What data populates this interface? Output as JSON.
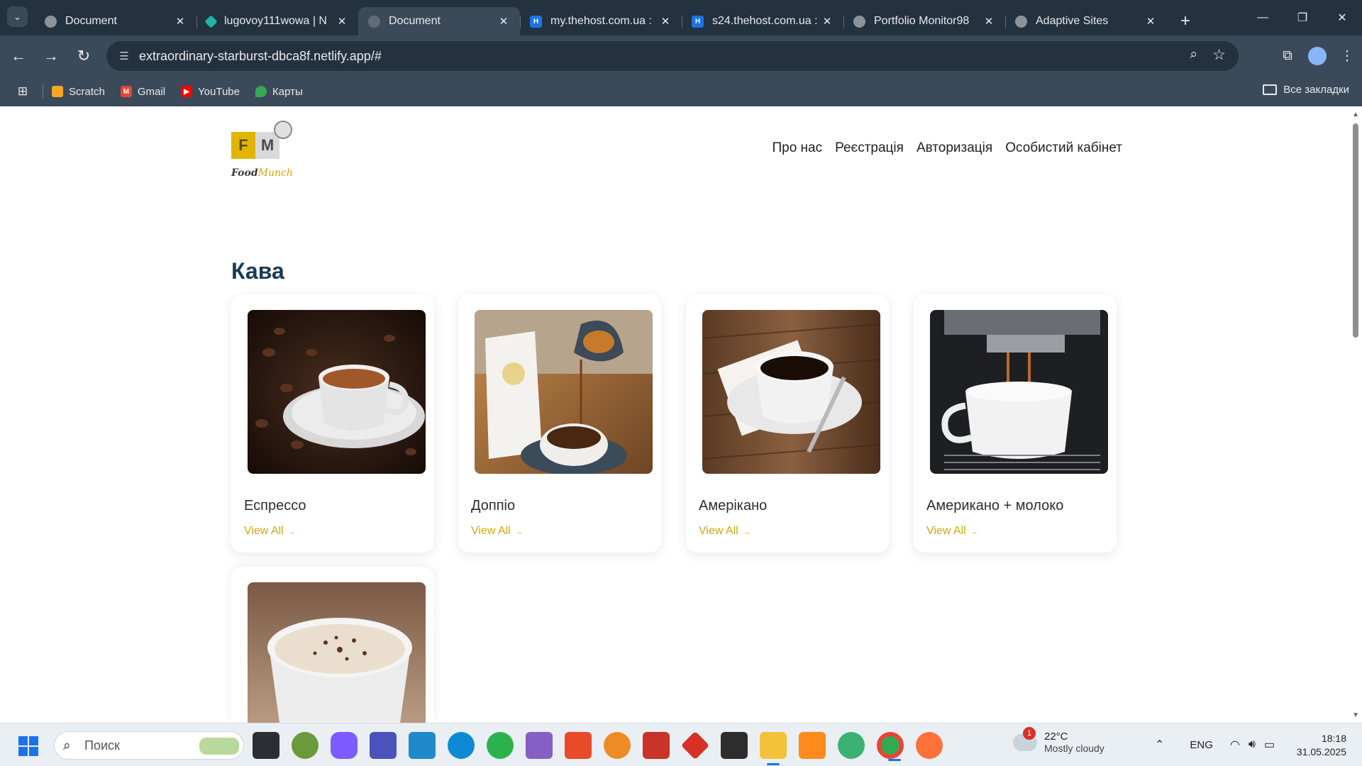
{
  "browser": {
    "tabs": [
      {
        "title": "Document",
        "favicon": "globe-icon",
        "active": false
      },
      {
        "title": "lugovoy111wowa | N",
        "favicon": "netlify-icon",
        "active": false
      },
      {
        "title": "Document",
        "favicon": "globe-icon",
        "active": true
      },
      {
        "title": "my.thehost.com.ua :",
        "favicon": "h-icon",
        "active": false
      },
      {
        "title": "s24.thehost.com.ua :",
        "favicon": "h-icon",
        "active": false
      },
      {
        "title": "Portfolio Monitor98",
        "favicon": "globe-icon",
        "active": false
      },
      {
        "title": "Adaptive Sites",
        "favicon": "globe-icon",
        "active": false
      }
    ],
    "url": "extraordinary-starburst-dbca8f.netlify.app/#",
    "bookmarks": [
      {
        "label": "Scratch",
        "icon": "scratch-icon",
        "color": "#f5a623"
      },
      {
        "label": "Gmail",
        "icon": "gmail-icon",
        "color": "#ea4335"
      },
      {
        "label": "YouTube",
        "icon": "youtube-icon",
        "color": "#ff0000"
      },
      {
        "label": "Карты",
        "icon": "maps-icon",
        "color": "#34a853"
      }
    ],
    "all_bookmarks": "Все закладки"
  },
  "site": {
    "logo": {
      "f": "F",
      "m": "M",
      "word_1": "Food",
      "word_2": "Munch"
    },
    "nav": [
      "Про нас",
      "Реєстрація",
      "Авторизація",
      "Особистий кабінет"
    ],
    "heading": "Кава",
    "cards": [
      {
        "name": "Еспрессо",
        "link": "View All"
      },
      {
        "name": "Доппіо",
        "link": "View All"
      },
      {
        "name": "Амерікано",
        "link": "View All"
      },
      {
        "name": "Американо + молоко",
        "link": "View All"
      },
      {
        "name": "",
        "link": ""
      }
    ],
    "accent_color": "#d0a70c",
    "heading_color": "#183b56"
  },
  "taskbar": {
    "search_placeholder": "Поиск",
    "weather": {
      "temp": "22°C",
      "desc": "Mostly cloudy",
      "badge": "1"
    },
    "lang": "ENG",
    "time": "18:18",
    "date": "31.05.2025"
  }
}
